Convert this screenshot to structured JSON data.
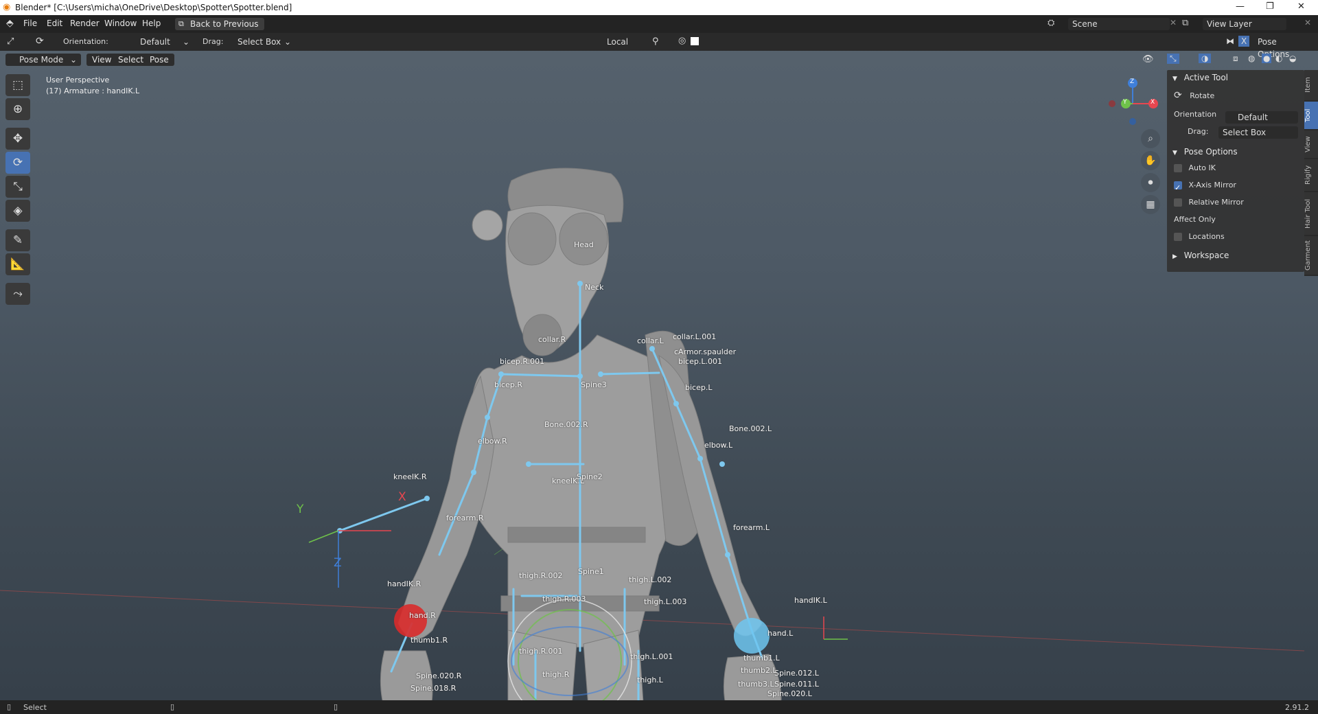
{
  "title_bar": {
    "title": "Blender* [C:\\Users\\micha\\OneDrive\\Desktop\\Spotter\\Spotter.blend]",
    "minimize": "—",
    "maximize": "❐",
    "close": "✕"
  },
  "menu": {
    "items": [
      "File",
      "Edit",
      "Render",
      "Window",
      "Help"
    ],
    "back_button": "Back to Previous",
    "scene_label": "Scene",
    "view_layer_label": "View Layer"
  },
  "tool_header": {
    "orientation_label": "Orientation:",
    "orientation_value": "Default",
    "drag_label": "Drag:",
    "drag_value": "Select Box",
    "pivot_value": "Local",
    "pose_options": "Pose Options"
  },
  "view_header": {
    "mode": "Pose Mode",
    "menus": [
      "View",
      "Select",
      "Pose"
    ]
  },
  "viewport": {
    "perspective": "User Perspective",
    "active_object": "(17) Armature : handIK.L",
    "gizmo_axes": {
      "x": "X",
      "y": "Y",
      "z": "Z"
    },
    "bone_labels": [
      "Head",
      "Neck",
      "collar.R",
      "collar.L",
      "collar.L.001",
      "cArmor.spaulder",
      "bicep.L.001",
      "bicep.R.001",
      "bicep.R",
      "Spine3",
      "bicep.L",
      "Bone.002.R",
      "Bone.002.L",
      "elbow.R",
      "elbow.L",
      "kneeIK.R",
      "kneeIK.L",
      "Spine2",
      "forearm.R",
      "forearm.L",
      "thigh.R.002",
      "Spine1",
      "thigh.L.002",
      "thigh.R.003",
      "thigh.L.003",
      "handIK.R",
      "handIK.L",
      "hand.R",
      "hand.L",
      "thumb1.R",
      "thumb1.L",
      "thigh.R.001",
      "thigh.L.001",
      "thigh.R",
      "thigh.L",
      "Spine.020.R",
      "Spine.018.R",
      "Spine.012.L",
      "thumb2.L",
      "thumb3.L",
      "Spine.011.L",
      "Spine.020.L"
    ],
    "axis_labels": [
      "Y",
      "X",
      "Z"
    ]
  },
  "sidebar": {
    "tabs": [
      "Item",
      "Tool",
      "View",
      "Rigify",
      "Hair Tool",
      "Garment"
    ],
    "active_tab": "Tool",
    "active_tool": {
      "header": "Active Tool",
      "tool_name": "Rotate",
      "orientation_label": "Orientation",
      "orientation_value": "Default",
      "drag_label": "Drag:",
      "drag_value": "Select Box"
    },
    "pose_options": {
      "header": "Pose Options",
      "auto_ik": {
        "label": "Auto IK",
        "checked": false
      },
      "x_axis_mirror": {
        "label": "X-Axis Mirror",
        "checked": true
      },
      "relative_mirror": {
        "label": "Relative Mirror",
        "checked": false
      },
      "affect_only_label": "Affect Only",
      "locations": {
        "label": "Locations",
        "checked": false
      }
    },
    "workspace_header": "Workspace"
  },
  "status_bar": {
    "select_label": "Select",
    "version": "2.91.2"
  },
  "colors": {
    "accent": "#4772b3",
    "bone": "#7ec8ee",
    "axis_x": "#e8464f",
    "axis_y": "#6fc24a",
    "axis_z": "#3f7fd9",
    "ik_right": "#d92b2b",
    "ik_left": "#6ec6f0"
  }
}
